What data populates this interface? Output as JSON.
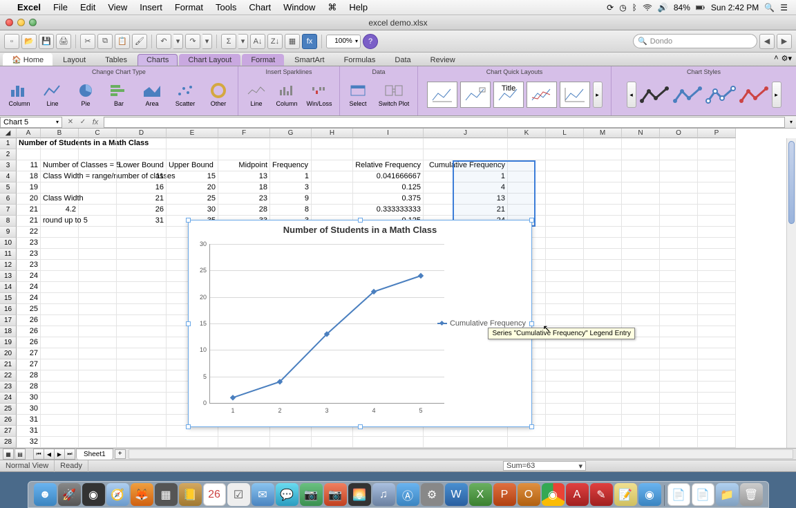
{
  "menubar": {
    "app": "Excel",
    "items": [
      "File",
      "Edit",
      "View",
      "Insert",
      "Format",
      "Tools",
      "Chart",
      "Window",
      "Help"
    ],
    "battery": "84%",
    "clock": "Sun 2:42 PM"
  },
  "window": {
    "title": "excel demo.xlsx"
  },
  "toolbar": {
    "zoom": "100%",
    "search_placeholder": "Dondo"
  },
  "ribbon": {
    "tabs": [
      "Home",
      "Layout",
      "Tables",
      "Charts",
      "Chart Layout",
      "Format",
      "SmartArt",
      "Formulas",
      "Data",
      "Review"
    ],
    "active": "Charts",
    "groups": {
      "chart_type": {
        "label": "Change Chart Type",
        "buttons": [
          "Column",
          "Line",
          "Pie",
          "Bar",
          "Area",
          "Scatter",
          "Other"
        ]
      },
      "sparklines": {
        "label": "Insert Sparklines",
        "buttons": [
          "Line",
          "Column",
          "Win/Loss"
        ]
      },
      "data": {
        "label": "Data",
        "buttons": [
          "Select",
          "Switch Plot"
        ]
      },
      "quick": {
        "label": "Chart Quick Layouts"
      },
      "styles": {
        "label": "Chart Styles"
      }
    }
  },
  "namebox": "Chart 5",
  "columns": [
    "A",
    "B",
    "C",
    "D",
    "E",
    "F",
    "G",
    "H",
    "I",
    "J",
    "K",
    "L",
    "M",
    "N",
    "O",
    "P"
  ],
  "table": {
    "title": "Number of Students in a Math Class",
    "headers": [
      "Lower Bound",
      "Upper Bound",
      "Midpoint",
      "Frequency",
      "Relative Frequency",
      "Cumulative Frequency"
    ],
    "rows": [
      {
        "lb": 11,
        "ub": 15,
        "mid": 13,
        "freq": 1,
        "rel": "0.041666667",
        "cum": 1
      },
      {
        "lb": 16,
        "ub": 20,
        "mid": 18,
        "freq": 3,
        "rel": "0.125",
        "cum": 4
      },
      {
        "lb": 21,
        "ub": 25,
        "mid": 23,
        "freq": 9,
        "rel": "0.375",
        "cum": 13
      },
      {
        "lb": 26,
        "ub": 30,
        "mid": 28,
        "freq": 8,
        "rel": "0.333333333",
        "cum": 21
      },
      {
        "lb": 31,
        "ub": 35,
        "mid": 33,
        "freq": 3,
        "rel": "0.125",
        "cum": 24
      }
    ],
    "notes": {
      "r3": "Number of Classes = 5",
      "r4": "Class Width = range/number of classes",
      "r6": "Class Width",
      "r7": "4.2",
      "r8": "round up to 5"
    },
    "colA": [
      11,
      18,
      19,
      20,
      21,
      21,
      22,
      23,
      23,
      23,
      24,
      24,
      24,
      25,
      26,
      26,
      26,
      27,
      27,
      28,
      28,
      30,
      30,
      31,
      31,
      32
    ]
  },
  "chart_data": {
    "type": "line",
    "title": "Number of Students in a Math Class",
    "series": [
      {
        "name": "Cumulative Frequency",
        "values": [
          1,
          4,
          13,
          21,
          24
        ]
      }
    ],
    "categories": [
      "1",
      "2",
      "3",
      "4",
      "5"
    ],
    "ylim": [
      0,
      30
    ],
    "yticks": [
      0,
      5,
      10,
      15,
      20,
      25,
      30
    ],
    "xlabel": "",
    "ylabel": ""
  },
  "tooltip": "Series \"Cumulative Frequency\" Legend Entry",
  "sheettabs": {
    "active": "Sheet1"
  },
  "status": {
    "view": "Normal View",
    "state": "Ready",
    "sum": "Sum=63"
  }
}
